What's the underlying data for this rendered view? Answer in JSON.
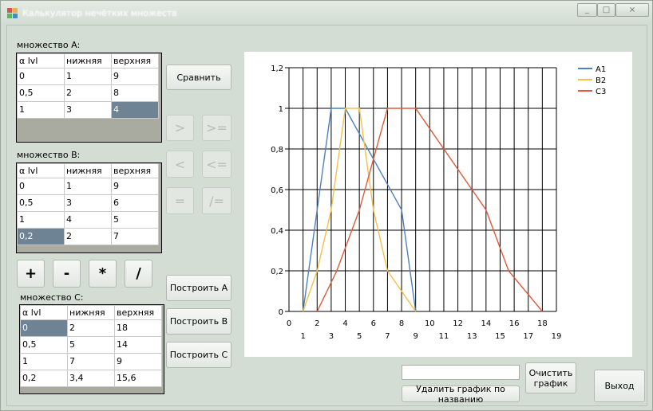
{
  "window": {
    "title": "Калькулятор нечётких множеств",
    "controls": [
      "_",
      "□",
      "×"
    ]
  },
  "set_a": {
    "label": "множество А:",
    "headers": [
      "α lvl",
      "нижняя",
      "верхняя"
    ],
    "rows": [
      [
        "0",
        "1",
        "9"
      ],
      [
        "0,5",
        "2",
        "8"
      ],
      [
        "1",
        "3",
        "4"
      ]
    ]
  },
  "set_b": {
    "label": "множество B:",
    "headers": [
      "α lvl",
      "нижняя",
      "верхняя"
    ],
    "rows": [
      [
        "0",
        "1",
        "9"
      ],
      [
        "0,5",
        "3",
        "6"
      ],
      [
        "1",
        "4",
        "5"
      ],
      [
        "0,2",
        "2",
        "7"
      ]
    ]
  },
  "set_c": {
    "label": "множество С:",
    "headers": [
      "α lvl",
      "нижняя",
      "верхняя"
    ],
    "rows": [
      [
        "0",
        "2",
        "18"
      ],
      [
        "0,5",
        "5",
        "14"
      ],
      [
        "1",
        "7",
        "9"
      ],
      [
        "0,2",
        "3,4",
        "15,6"
      ]
    ]
  },
  "buttons": {
    "compare": "Сравнить",
    "gt": ">",
    "gte": ">=",
    "lt": "<",
    "lte": "<=",
    "eq": "=",
    "neq": "/=",
    "plus": "+",
    "minus": "-",
    "mul": "*",
    "div": "/",
    "build_a": "Построить А",
    "build_b": "Построить В",
    "build_c": "Построить С",
    "delete_graph": "Удалить график по названию",
    "clear_graph": "Очистить график",
    "exit": "Выход"
  },
  "graph_name_input": {
    "value": ""
  },
  "chart_data": {
    "type": "line",
    "xlim": [
      0,
      19
    ],
    "ylim": [
      0,
      1.2
    ],
    "x_ticks_row1": [
      "0",
      "2",
      "4",
      "6",
      "8",
      "10",
      "12",
      "14",
      "16",
      "18"
    ],
    "x_ticks_row2": [
      "1",
      "3",
      "5",
      "7",
      "9",
      "11",
      "13",
      "15",
      "17",
      "19"
    ],
    "y_ticks": [
      "0",
      "0,2",
      "0,4",
      "0,6",
      "0,8",
      "1",
      "1,2"
    ],
    "grid": true,
    "legend_position": "top-right",
    "series": [
      {
        "name": "A1",
        "color": "#4f81bd",
        "points": [
          [
            1,
            0
          ],
          [
            2,
            0.5
          ],
          [
            3,
            1
          ],
          [
            4,
            1
          ],
          [
            8,
            0.5
          ],
          [
            9,
            0
          ]
        ]
      },
      {
        "name": "B2",
        "color": "#f5c04a",
        "points": [
          [
            1,
            0
          ],
          [
            2,
            0.2
          ],
          [
            3,
            0.5
          ],
          [
            4,
            1
          ],
          [
            5,
            1
          ],
          [
            6,
            0.5
          ],
          [
            7,
            0.2
          ],
          [
            9,
            0
          ]
        ]
      },
      {
        "name": "C3",
        "color": "#e05a3a",
        "points": [
          [
            2,
            0
          ],
          [
            3.4,
            0.2
          ],
          [
            5,
            0.5
          ],
          [
            7,
            1
          ],
          [
            9,
            1
          ],
          [
            14,
            0.5
          ],
          [
            15.6,
            0.2
          ],
          [
            18,
            0
          ]
        ]
      }
    ]
  }
}
